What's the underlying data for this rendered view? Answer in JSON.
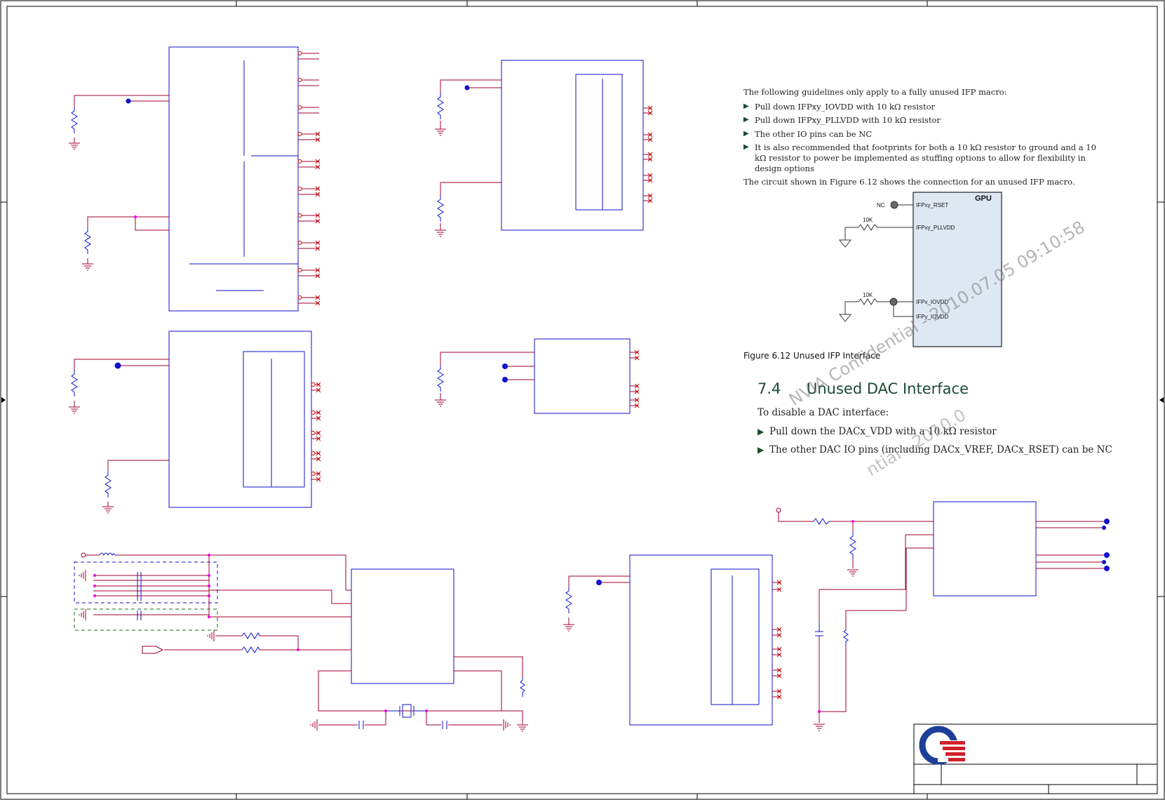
{
  "doc": {
    "intro": "The following guidelines only apply to a fully unused IFP macro:",
    "bullets": [
      "Pull down IFPxy_IOVDD with 10 kΩ resistor",
      "Pull down IFPxy_PLLVDD with 10 kΩ resistor",
      "The other IO pins can be NC",
      "It is also recommended that footprints for both a 10 kΩ resistor to ground and a 10 kΩ resistor to power be implemented as stuffing options to allow for flexibility in design options"
    ],
    "circuit_note": "The circuit shown in Figure 6.12 shows the connection for an unused IFP macro."
  },
  "figure": {
    "gpu_label": "GPU",
    "nc_label": "NC",
    "r1_label": "10K",
    "r2_label": "10K",
    "pins": [
      "IFPxy_RSET",
      "IFPxy_PLLVDD",
      "IFPx_IOVDD",
      "IFPy_IOVDD"
    ],
    "caption": "Figure 6.12  Unused IFP Interface"
  },
  "dac": {
    "number": "7.4",
    "title": "Unused DAC Interface",
    "intro": "To disable a DAC interface:",
    "bullets": [
      "Pull down the DACx_VDD with a 10 kΩ resistor",
      "The other DAC IO pins (including DACx_VREF, DACx_RSET) can be NC"
    ]
  },
  "watermark": {
    "line1": "NVIA Confidential - 2010.07.05 09:10:58",
    "line2": "ntial - 2010.0"
  },
  "colors": {
    "wire": "#a0002a",
    "component": "#1010cc",
    "junction": "#ee00ee",
    "pin_x": "#cc0000",
    "border": "#000000",
    "gpu_fill": "#dde8f3",
    "logo_blue": "#1d3f9a",
    "logo_red": "#d2202a"
  }
}
